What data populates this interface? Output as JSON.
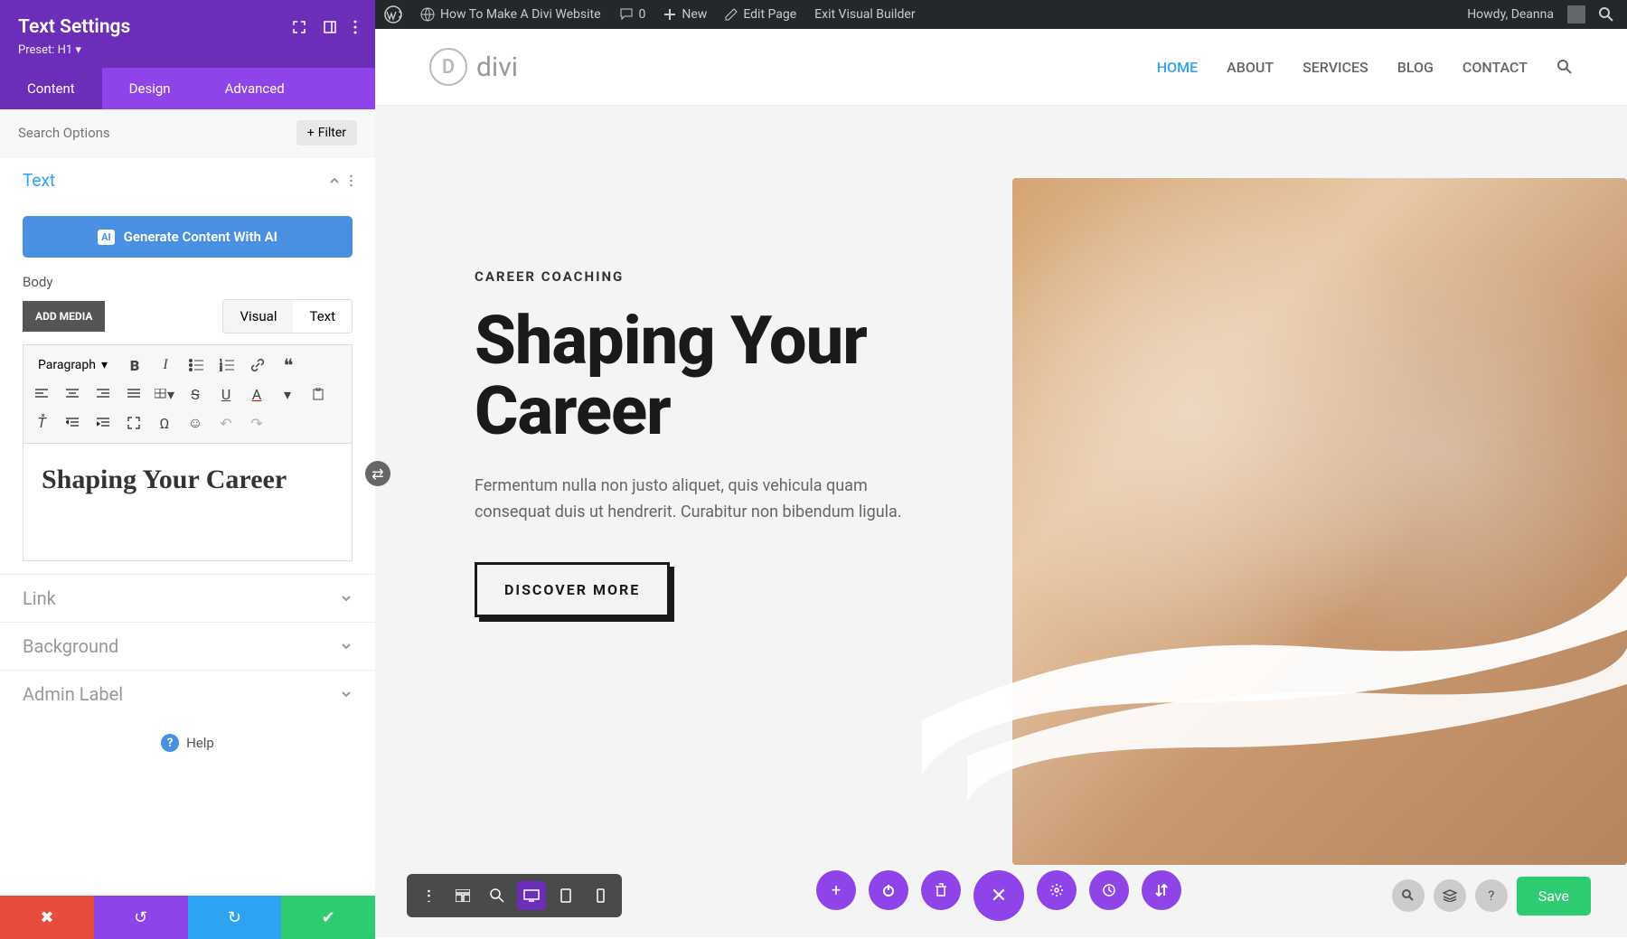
{
  "wp_bar": {
    "site": "How To Make A Divi Website",
    "comments": "0",
    "new": "New",
    "edit": "Edit Page",
    "exit": "Exit Visual Builder",
    "greeting": "Howdy, Deanna"
  },
  "sidebar": {
    "title": "Text Settings",
    "preset": "Preset: H1",
    "tabs": [
      "Content",
      "Design",
      "Advanced"
    ],
    "active_tab": 0,
    "search_placeholder": "Search Options",
    "filter": "Filter",
    "text_section": "Text",
    "ai_button": "Generate Content With AI",
    "body_label": "Body",
    "add_media": "ADD MEDIA",
    "editor_tabs": [
      "Visual",
      "Text"
    ],
    "editor_active": 0,
    "format_select": "Paragraph",
    "editor_content": "Shaping Your Career",
    "sections": [
      "Link",
      "Background",
      "Admin Label"
    ],
    "help": "Help"
  },
  "nav": [
    "HOME",
    "ABOUT",
    "SERVICES",
    "BLOG",
    "CONTACT"
  ],
  "nav_active": 0,
  "logo": "divi",
  "hero": {
    "kicker": "CAREER COACHING",
    "title": "Shaping Your Career",
    "paragraph": "Fermentum nulla non justo aliquet, quis vehicula quam consequat duis ut hendrerit. Curabitur non bibendum ligula.",
    "cta": "DISCOVER MORE"
  },
  "builder": {
    "save": "Save"
  }
}
